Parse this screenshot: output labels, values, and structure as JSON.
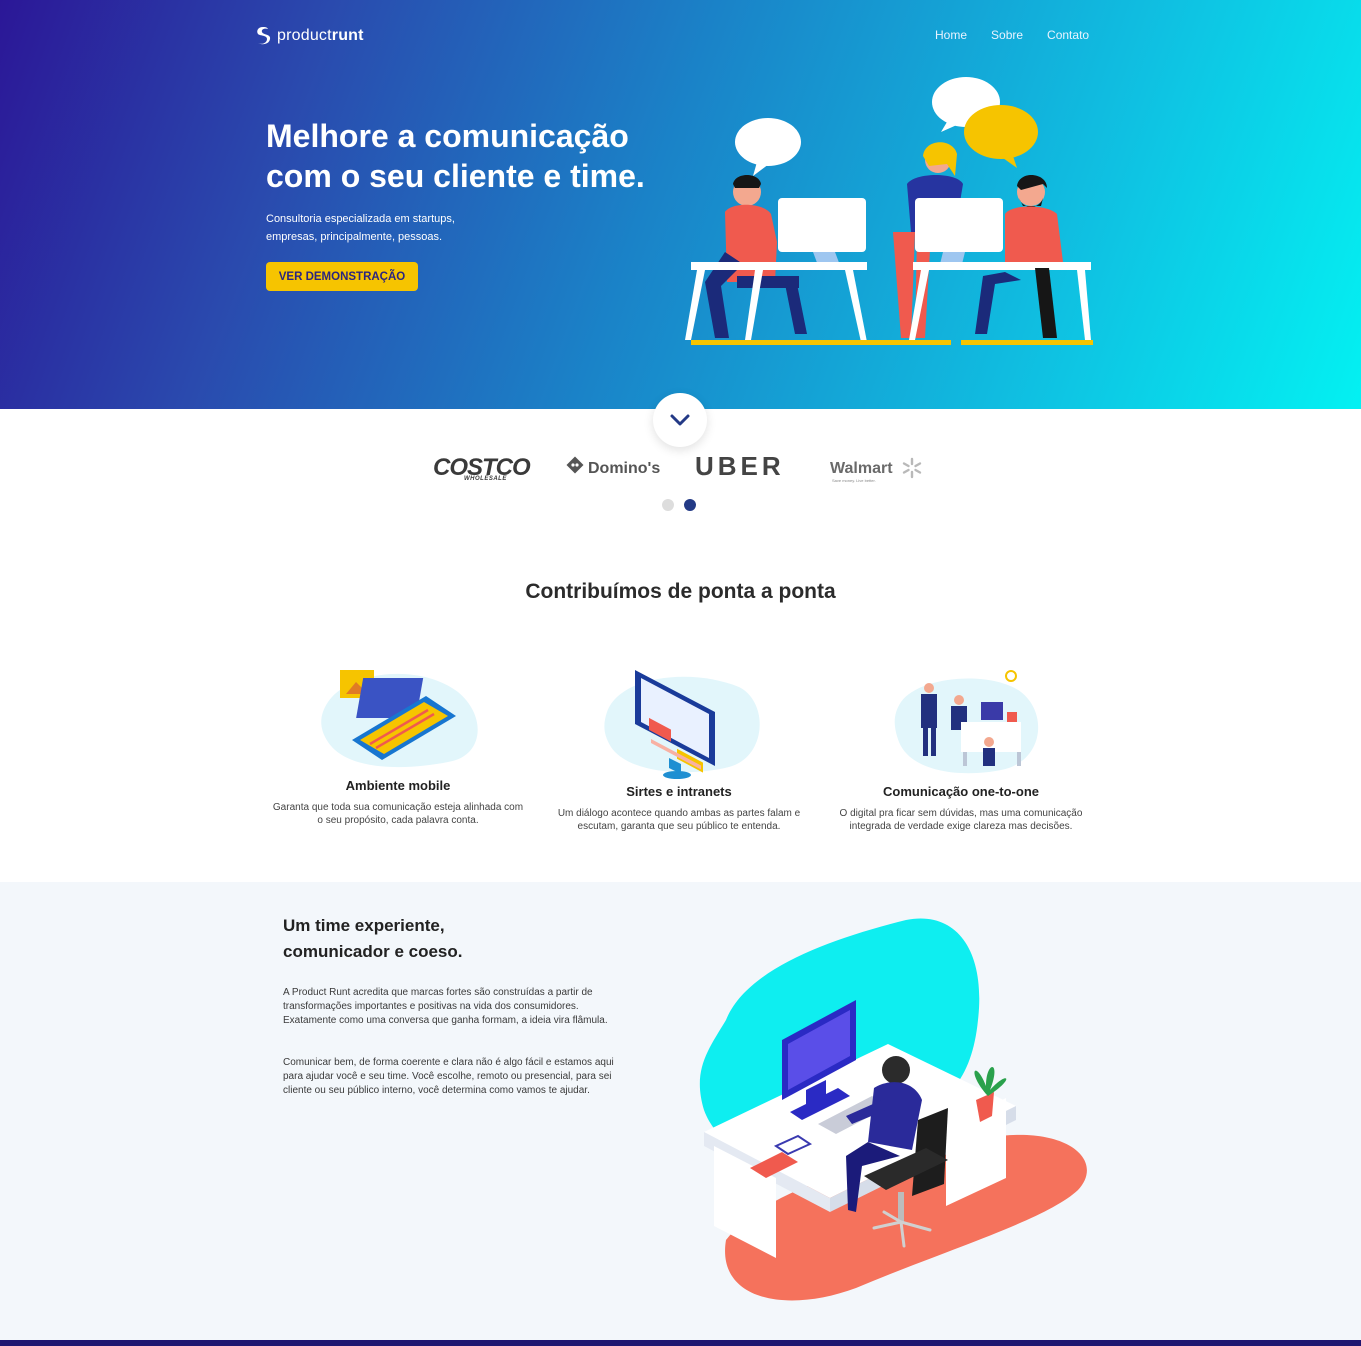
{
  "brand": {
    "name_light": "product",
    "name_bold": "runt"
  },
  "nav": {
    "items": [
      {
        "label": "Home"
      },
      {
        "label": "Sobre"
      },
      {
        "label": "Contato"
      }
    ]
  },
  "hero": {
    "title_line1": "Melhore a comunicação",
    "title_line2": "com o seu cliente e time.",
    "subtitle_line1": "Consultoria especializada em startups,",
    "subtitle_line2": "empresas, principalmente, pessoas.",
    "cta_label": "VER DEMONSTRAÇÃO",
    "accent": "#f6c400"
  },
  "scroll_icon": "chevron-down-icon",
  "clients": {
    "logos": [
      {
        "name": "COSTCO",
        "sub": "WHOLESALE"
      },
      {
        "name": "Domino's"
      },
      {
        "name": "UBER"
      },
      {
        "name": "Walmart",
        "sub": "Save money. Live better."
      }
    ],
    "carousel": {
      "pages": 2,
      "active": 2
    }
  },
  "services": {
    "title": "Contribuímos de ponta a ponta",
    "items": [
      {
        "title": "Ambiente mobile",
        "desc_line1": "Garanta que toda sua comunicação esteja alinhada com",
        "desc_line2": "o seu propósito, cada palavra conta."
      },
      {
        "title": "Sirtes e intranets",
        "desc_line1": "Um diálogo acontece quando ambas as partes falam e",
        "desc_line2": "escutam, garanta que seu público te entenda."
      },
      {
        "title": "Comunicação one-to-one",
        "desc_line1": "O digital pra ficar sem dúvidas, mas uma comunicação",
        "desc_line2": "integrada de verdade exige clareza mas decisões."
      }
    ]
  },
  "team": {
    "title_line1": "Um time experiente,",
    "title_line2": "comunicador e coeso.",
    "p1": "A Product Runt acredita que marcas fortes são construídas a partir de transformações importantes e positivas na vida dos consumidores. Exatamente como uma conversa que ganha formam, a ideia vira flâmula.",
    "p2": "Comunicar bem, de forma coerente e clara não é algo fácil e estamos aqui para ajudar você e seu time. Você escolhe, remoto ou presencial, para sei cliente ou seu público interno, você determina como vamos te ajudar."
  },
  "colors": {
    "hero_start": "#2b1797",
    "hero_end": "#03f1f2",
    "dark_blue": "#233a86",
    "coral": "#f5725c",
    "cyan": "#0eeef0"
  }
}
